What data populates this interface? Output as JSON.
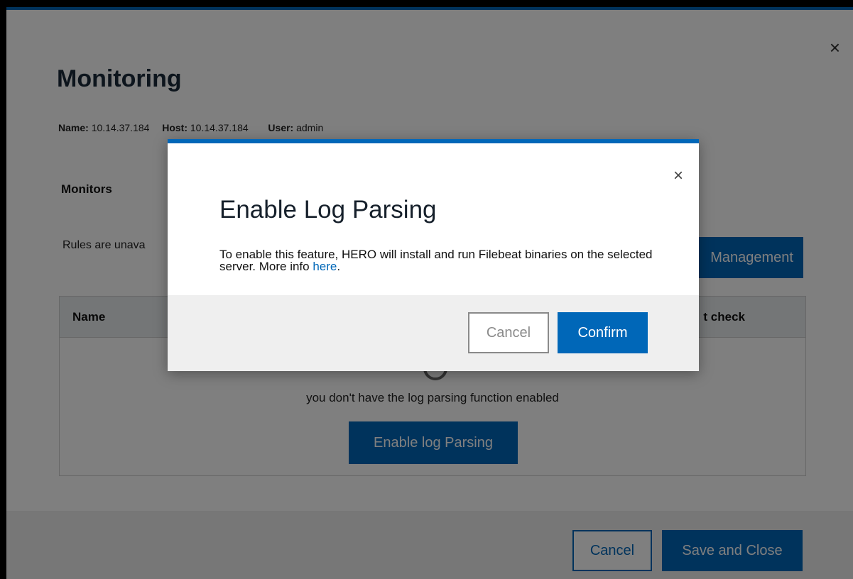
{
  "outer": {
    "close_icon": "×",
    "title": "Monitoring",
    "meta": {
      "name_label": "Name:",
      "name_value": "10.14.37.184",
      "host_label": "Host:",
      "host_value": "10.14.37.184",
      "user_label": "User:",
      "user_value": "admin"
    },
    "section_title": "Monitors",
    "rules_text": "Rules are unava",
    "management_button": "Management",
    "table": {
      "columns": [
        "Name",
        "t check"
      ],
      "empty_text": "you don't have the log parsing function enabled",
      "enable_button": "Enable log Parsing"
    },
    "footer": {
      "cancel": "Cancel",
      "save": "Save and Close"
    }
  },
  "dialog": {
    "close_icon": "×",
    "title": "Enable Log Parsing",
    "body_text": "To enable this feature, HERO will install and run Filebeat binaries on the selected server. More info ",
    "link_text": "here",
    "body_suffix": ".",
    "cancel": "Cancel",
    "confirm": "Confirm"
  },
  "colors": {
    "accent": "#0067b8",
    "overlay": "rgba(0,0,0,0.5)"
  }
}
